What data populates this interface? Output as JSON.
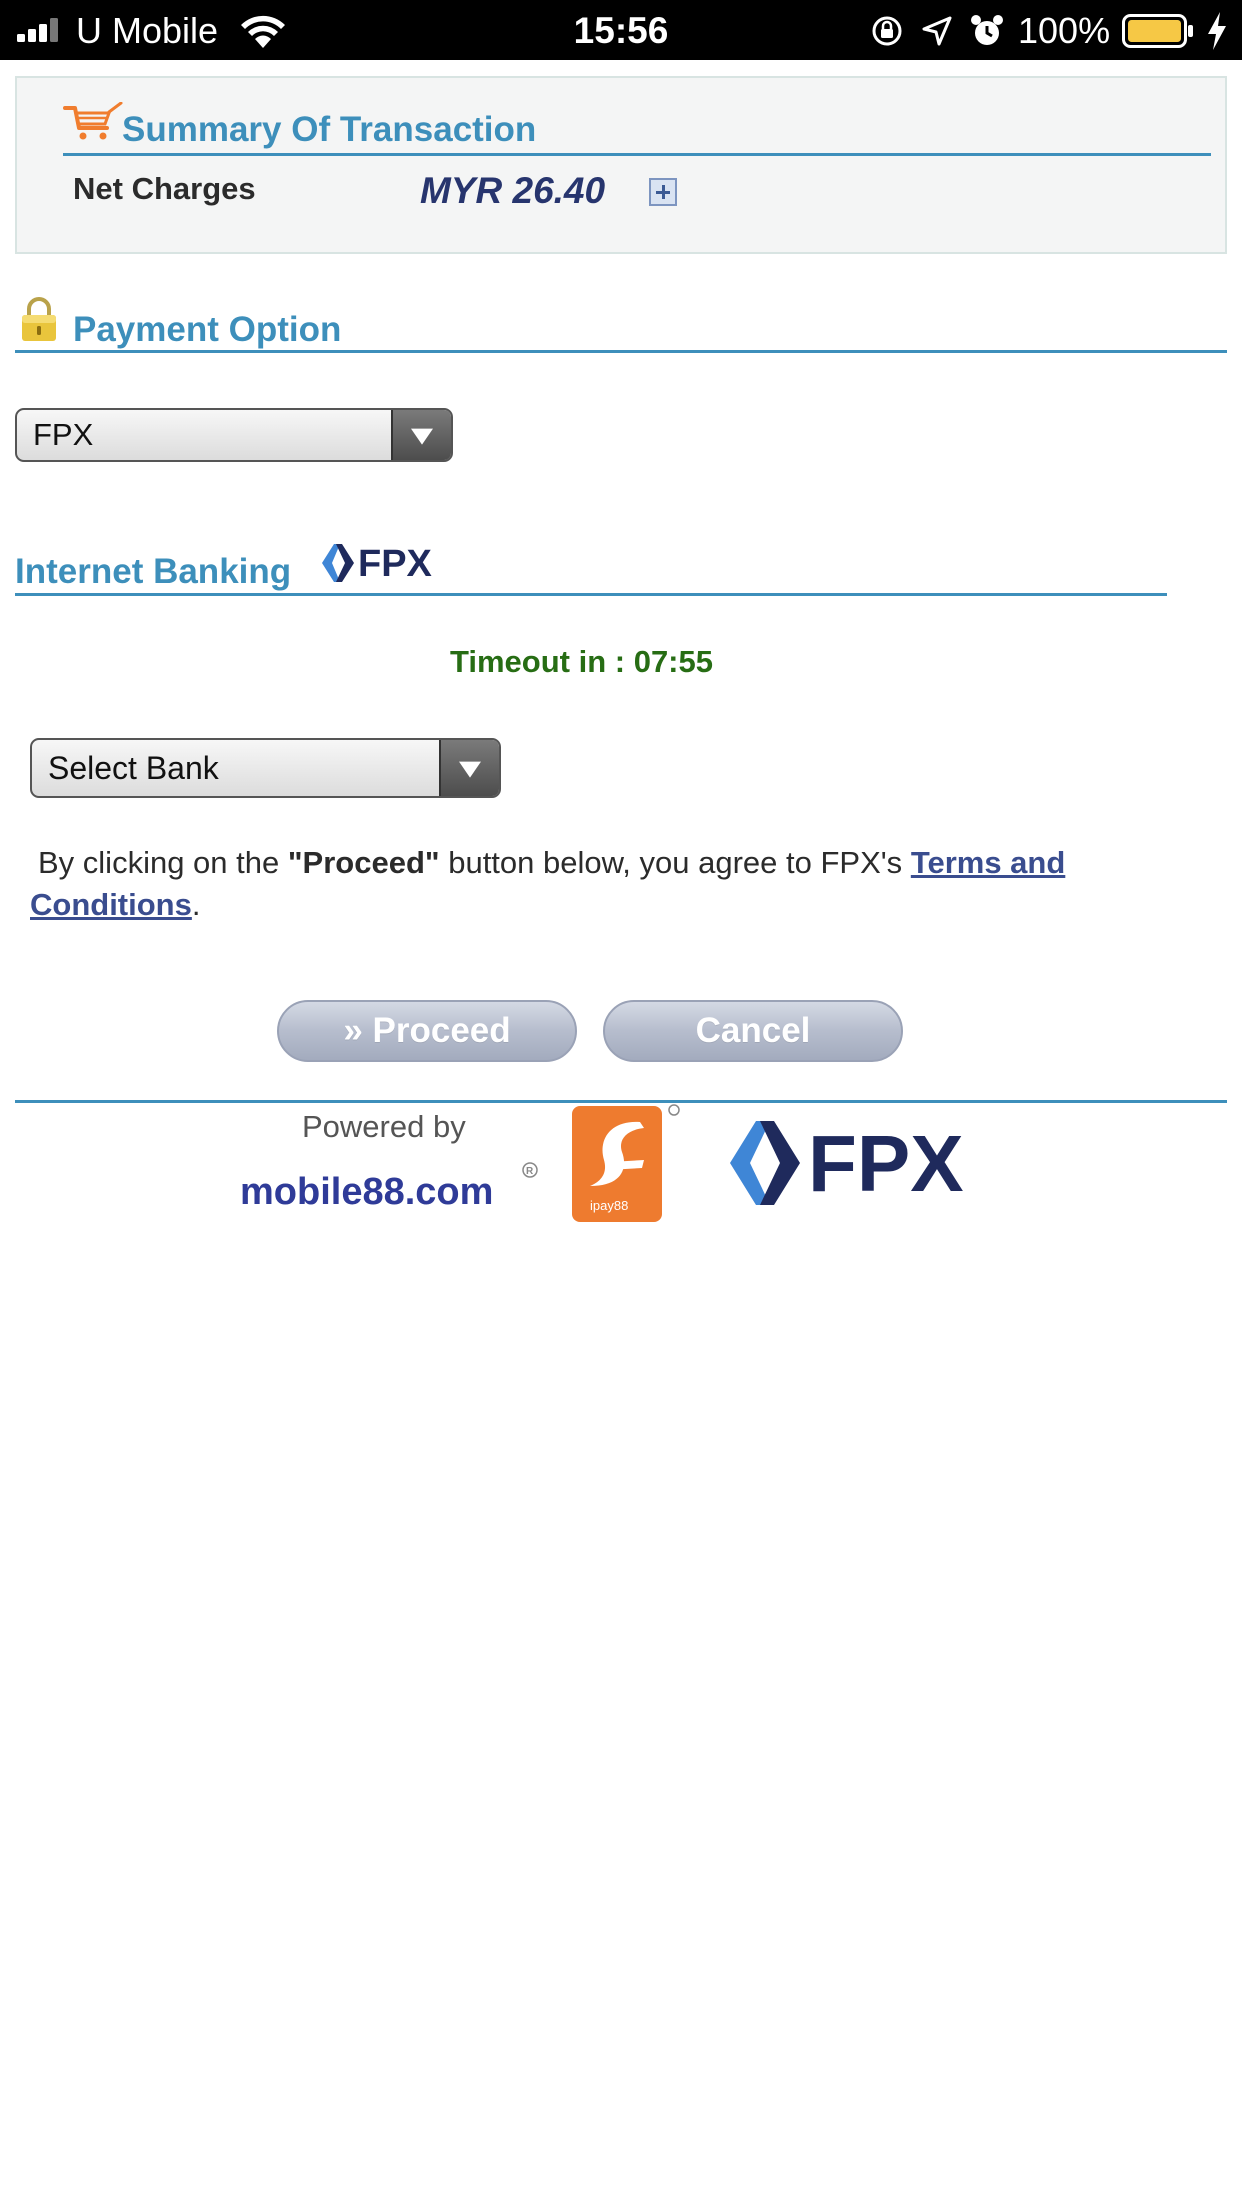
{
  "status_bar": {
    "carrier": "U Mobile",
    "time": "15:56",
    "battery_percent": "100%"
  },
  "summary": {
    "title": "Summary Of Transaction",
    "net_charges_label": "Net Charges",
    "net_charges_value": "MYR 26.40"
  },
  "payment": {
    "title": "Payment Option",
    "selected_option": "FPX"
  },
  "internet_banking": {
    "title": "Internet Banking",
    "logo_text": "FPX",
    "timeout_text": "Timeout in : 07:55",
    "bank_select_value": "Select Bank"
  },
  "agreement": {
    "prefix": "By clicking on the ",
    "proceed_ref": "\"Proceed\"",
    "middle": " button below, you agree to FPX's ",
    "terms_link": "Terms and Conditions",
    "suffix": "."
  },
  "buttons": {
    "proceed_label": "» Proceed",
    "cancel_label": "Cancel"
  },
  "footer": {
    "powered_by": "Powered by",
    "mobile88_text": "mobile88.com",
    "ipay88_text": "ipay88",
    "fpx_text": "FPX"
  },
  "colors": {
    "section_title": "#3d8fbb",
    "amount": "#27356e",
    "timeout": "#276d14",
    "link": "#3a4d8f",
    "fpx_navy": "#1f2a5c",
    "fpx_blue": "#3f86d6",
    "ipay88_orange": "#ee7b2f",
    "mobile88_blue": "#2f3b98",
    "mobile88_red": "#d92f2f"
  }
}
